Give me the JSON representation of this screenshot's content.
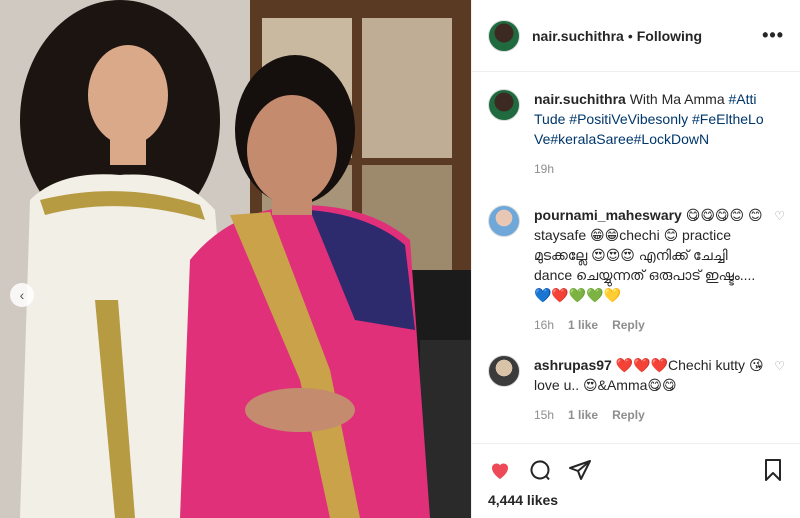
{
  "post": {
    "header": {
      "username": "nair.suchithra",
      "separator": "•",
      "follow_status": "Following",
      "more_icon": "more-options-icon"
    },
    "caption": {
      "username": "nair.suchithra",
      "text": "With Ma Amma",
      "hashtags": "#AttiTude #PositiVeVibesonly #FeEltheLoVe#keralaSaree#LockDowN",
      "time": "19h"
    },
    "comments": [
      {
        "username": "pournami_maheswary",
        "text": "😋😋😋😊 😊staysafe 😁😁chechi 😊 practice മുടക്കല്ലേ 😍😍😍 എനിക്ക് ചേച്ചി dance ചെയ്യുന്നത് ഒരുപാട് ഇഷ്ടം.... 💙❤️💚💚💛",
        "time": "16h",
        "likes": "1 like",
        "reply": "Reply"
      },
      {
        "username": "ashrupas97",
        "text": "❤️❤️❤️Chechi kutty 😘love u.. 😍&Amma😋😋",
        "time": "15h",
        "likes": "1 like",
        "reply": "Reply"
      }
    ],
    "likes": "4,444 likes"
  }
}
